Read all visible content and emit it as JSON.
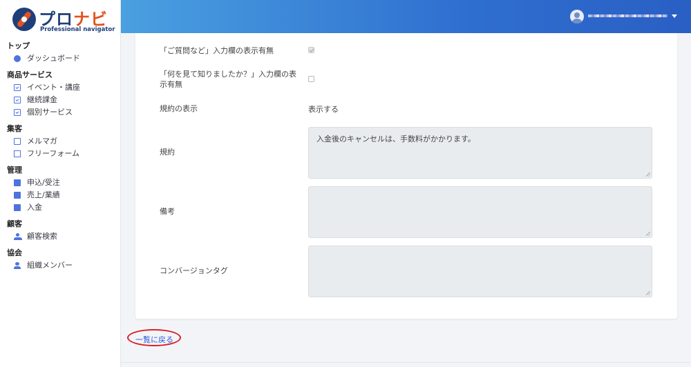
{
  "brand": {
    "logo_main_1": "プロ",
    "logo_main_2": "ナビ",
    "logo_sub": "Professional navigator"
  },
  "sidebar": {
    "sections": [
      {
        "title": "トップ",
        "items": [
          {
            "label": "ダッシュボード",
            "icon": "dashboard-icon"
          }
        ]
      },
      {
        "title": "商品サービス",
        "items": [
          {
            "label": "イベント・講座",
            "icon": "calendar-check-icon"
          },
          {
            "label": "継続課金",
            "icon": "calendar-check-icon"
          },
          {
            "label": "個別サービス",
            "icon": "calendar-check-icon"
          }
        ]
      },
      {
        "title": "集客",
        "items": [
          {
            "label": "メルマガ",
            "icon": "envelope-icon"
          },
          {
            "label": "フリーフォーム",
            "icon": "form-icon"
          }
        ]
      },
      {
        "title": "管理",
        "items": [
          {
            "label": "申込/受注",
            "icon": "calendar-icon"
          },
          {
            "label": "売上/業績",
            "icon": "calendar-icon"
          },
          {
            "label": "入金",
            "icon": "calendar-icon"
          }
        ]
      },
      {
        "title": "顧客",
        "items": [
          {
            "label": "顧客検索",
            "icon": "users-icon"
          }
        ]
      },
      {
        "title": "協会",
        "items": [
          {
            "label": "組織メンバー",
            "icon": "user-icon"
          }
        ]
      }
    ]
  },
  "topbar": {
    "user_name": "■■■■■■■■■■■■",
    "accent_color": "#2f6fd0"
  },
  "form": {
    "question_field": {
      "label": "「ご質問など」入力欄の表示有無",
      "checked": true
    },
    "referral_field": {
      "label_line1": "「何を見て知りましたか？」入力欄の表",
      "label_line2": "示有無",
      "checked": false
    },
    "terms_display": {
      "label": "規約の表示",
      "value": "表示する"
    },
    "terms": {
      "label": "規約",
      "value": "入金後のキャンセルは、手数料がかかります。"
    },
    "notes": {
      "label": "備考",
      "value": ""
    },
    "conversion_tag": {
      "label": "コンバージョンタグ",
      "value": ""
    }
  },
  "back_link": "一覧に戻る"
}
